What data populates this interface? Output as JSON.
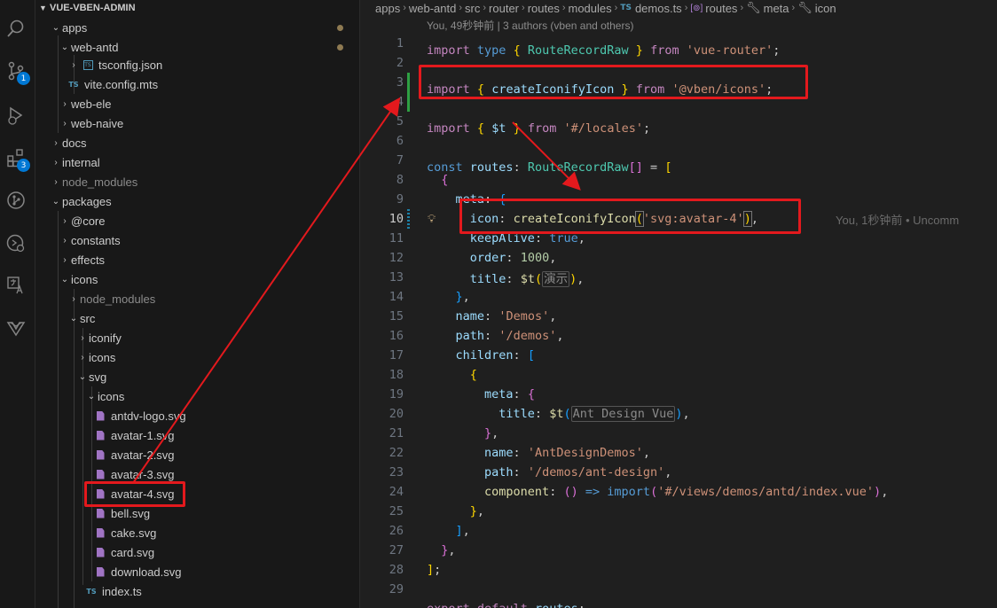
{
  "activity": {
    "scm_badge": "1",
    "ext_badge": "3"
  },
  "explorer": {
    "root": "VUE-VBEN-ADMIN",
    "items": [
      {
        "label": "apps"
      },
      {
        "label": "web-antd"
      },
      {
        "label": "tsconfig.json"
      },
      {
        "label": "vite.config.mts"
      },
      {
        "label": "web-ele"
      },
      {
        "label": "web-naive"
      },
      {
        "label": "docs"
      },
      {
        "label": "internal"
      },
      {
        "label": "node_modules"
      },
      {
        "label": "packages"
      },
      {
        "label": "@core"
      },
      {
        "label": "constants"
      },
      {
        "label": "effects"
      },
      {
        "label": "icons"
      },
      {
        "label": "node_modules"
      },
      {
        "label": "src"
      },
      {
        "label": "iconify"
      },
      {
        "label": "icons"
      },
      {
        "label": "svg"
      },
      {
        "label": "icons"
      },
      {
        "label": "antdv-logo.svg"
      },
      {
        "label": "avatar-1.svg"
      },
      {
        "label": "avatar-2.svg"
      },
      {
        "label": "avatar-3.svg"
      },
      {
        "label": "avatar-4.svg"
      },
      {
        "label": "bell.svg"
      },
      {
        "label": "cake.svg"
      },
      {
        "label": "card.svg"
      },
      {
        "label": "download.svg"
      },
      {
        "label": "index.ts"
      }
    ],
    "ts_label": "TS"
  },
  "breadcrumb": {
    "items": [
      "apps",
      "web-antd",
      "src",
      "router",
      "routes",
      "modules",
      "demos.ts",
      "routes",
      "meta",
      "icon"
    ],
    "ts_label": "TS"
  },
  "blame_header": "You, 49秒钟前 | 3 authors (vben and others)",
  "inline_blame": "You, 1秒钟前 • Uncomm",
  "line_numbers": [
    "1",
    "2",
    "3",
    "4",
    "5",
    "6",
    "7",
    "8",
    "9",
    "10",
    "11",
    "12",
    "13",
    "14",
    "15",
    "16",
    "17",
    "18",
    "19",
    "20",
    "21",
    "22",
    "23",
    "24",
    "25",
    "26",
    "27",
    "28",
    "29"
  ],
  "code": {
    "l1": [
      "import",
      "type",
      "{",
      "RouteRecordRaw",
      "}",
      "from",
      "'vue-router'",
      ";"
    ],
    "l3": [
      "import",
      "{",
      "createIconifyIcon",
      "}",
      "from",
      "'@vben/icons'",
      ";"
    ],
    "l5": [
      "import",
      "{",
      "$t",
      "}",
      "from",
      "'#/locales'",
      ";"
    ],
    "l7": [
      "const",
      "routes",
      ":",
      "RouteRecordRaw",
      "[]",
      "=",
      "["
    ],
    "l8": "{",
    "l9": [
      "meta",
      ":",
      "{"
    ],
    "l10": [
      "icon",
      ":",
      "createIconifyIcon",
      "(",
      "'svg:avatar-4'",
      ")",
      ","
    ],
    "l11": [
      "keepAlive",
      ":",
      "true",
      ","
    ],
    "l12": [
      "order",
      ":",
      "1000",
      ","
    ],
    "l13": [
      "title",
      ":",
      "$t",
      "(",
      "演示",
      ")",
      ","
    ],
    "l14": [
      "}",
      ","
    ],
    "l15": [
      "name",
      ":",
      "'Demos'",
      ","
    ],
    "l16": [
      "path",
      ":",
      "'/demos'",
      ","
    ],
    "l17": [
      "children",
      ":",
      "["
    ],
    "l18": "{",
    "l19": [
      "meta",
      ":",
      "{"
    ],
    "l20": [
      "title",
      ":",
      "$t",
      "(",
      "Ant Design Vue",
      ")",
      ","
    ],
    "l21": [
      "}",
      ","
    ],
    "l22": [
      "name",
      ":",
      "'AntDesignDemos'",
      ","
    ],
    "l23": [
      "path",
      ":",
      "'/demos/ant-design'",
      ","
    ],
    "l24": [
      "component",
      ":",
      "()",
      "=>",
      "import",
      "(",
      "'#/views/demos/antd/index.vue'",
      ")",
      ","
    ],
    "l25": [
      "}",
      ","
    ],
    "l26": [
      "]",
      ","
    ],
    "l27": [
      "}",
      ","
    ],
    "l28": [
      "]",
      ";"
    ],
    "l29": [
      "export",
      "default",
      "routes",
      ";"
    ]
  }
}
